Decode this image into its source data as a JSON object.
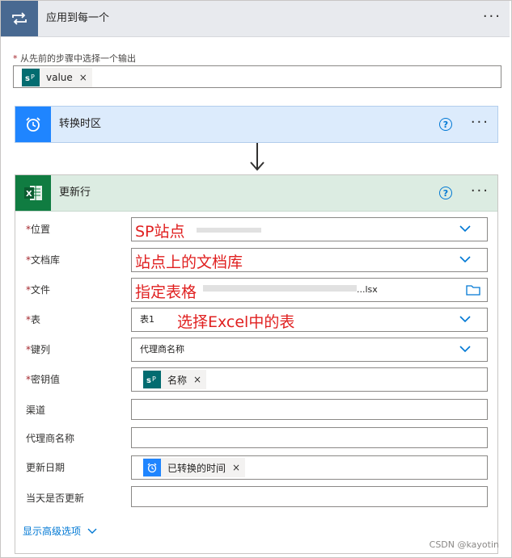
{
  "loop": {
    "title": "应用到每一个",
    "menu_label": "···",
    "prompt_label": "从先前的步骤中选择一个输出",
    "required_mark": "*",
    "token": {
      "label": "value",
      "icon": "sharepoint-icon",
      "remove": "×"
    }
  },
  "convert_card": {
    "title": "转换时区",
    "icon": "alarm-clock-icon",
    "help": "?",
    "menu_label": "···",
    "accent": "#1f85ff"
  },
  "update_card": {
    "title": "更新行",
    "icon": "excel-icon",
    "help": "?",
    "menu_label": "···",
    "accent": "#107c41",
    "fields": [
      {
        "label": "位置",
        "required": true,
        "value": "SP站点",
        "annotation": "SP站点",
        "control": "dropdown"
      },
      {
        "label": "文档库",
        "required": true,
        "value": "",
        "annotation": "站点上的文档库",
        "control": "dropdown"
      },
      {
        "label": "文件",
        "required": true,
        "value": "...lsx",
        "annotation": "指定表格",
        "control": "file-picker"
      },
      {
        "label": "表",
        "required": true,
        "value": "表1",
        "annotation": "选择Excel中的表",
        "control": "dropdown"
      },
      {
        "label": "键列",
        "required": true,
        "value": "代理商名称",
        "annotation": "",
        "control": "dropdown"
      },
      {
        "label": "密钥值",
        "required": true,
        "token": {
          "label": "名称",
          "icon": "sharepoint-icon",
          "remove": "×"
        }
      },
      {
        "label": "渠道",
        "required": false,
        "value": ""
      },
      {
        "label": "代理商名称",
        "required": false,
        "value": ""
      },
      {
        "label": "更新日期",
        "required": false,
        "token": {
          "label": "已转换的时间",
          "icon": "alarm-clock-icon",
          "remove": "×"
        }
      },
      {
        "label": "当天是否更新",
        "required": false,
        "value": ""
      }
    ],
    "advanced_options": "显示高级选项"
  },
  "watermark": "CSDN @kayotin",
  "colors": {
    "loop_header": "#486991",
    "sharepoint": "#036c70",
    "excel": "#107c41",
    "link": "#0078d4",
    "annotation": "#e02020"
  }
}
